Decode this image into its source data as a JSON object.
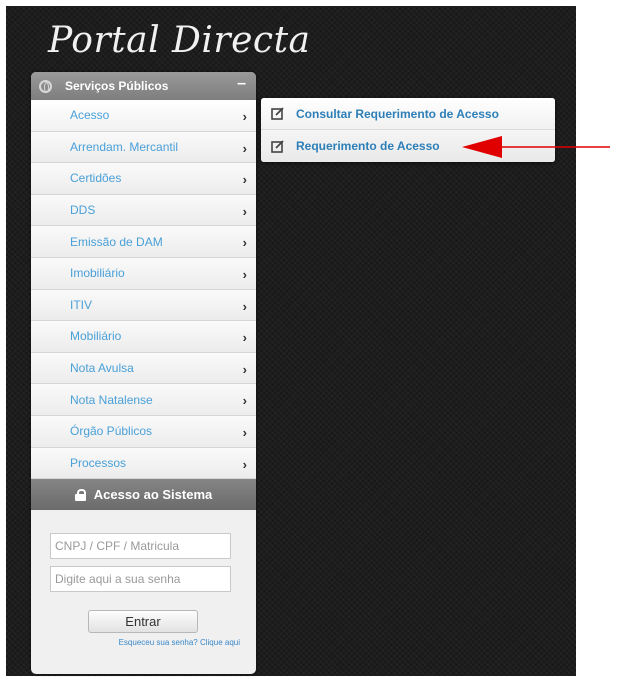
{
  "logo": "Portal Directa",
  "section": {
    "title": "Serviços Públicos",
    "toggle": "–",
    "icon": "globe-icon"
  },
  "menu": [
    {
      "label": "Acesso",
      "chevron": "›"
    },
    {
      "label": "Arrendam. Mercantil",
      "chevron": "›"
    },
    {
      "label": "Certidões",
      "chevron": "›"
    },
    {
      "label": "DDS",
      "chevron": "›"
    },
    {
      "label": "Emissão de DAM",
      "chevron": "›"
    },
    {
      "label": "Imobiliário",
      "chevron": "›"
    },
    {
      "label": "ITIV",
      "chevron": "›"
    },
    {
      "label": "Mobiliário",
      "chevron": "›"
    },
    {
      "label": "Nota Avulsa",
      "chevron": "›"
    },
    {
      "label": "Nota Natalense",
      "chevron": "›"
    },
    {
      "label": "Órgão Públicos",
      "chevron": "›"
    },
    {
      "label": "Processos",
      "chevron": "›"
    }
  ],
  "system": {
    "title": "Acesso ao Sistema",
    "icon": "lock-icon"
  },
  "login": {
    "user_placeholder": "CNPJ / CPF / Matricula",
    "password_placeholder": "Digite aqui a sua senha",
    "button_label": "Entrar",
    "forgot_link": "Esqueceu sua senha? Clique aqui"
  },
  "submenu": [
    {
      "label": "Consultar Requerimento de Acesso",
      "icon": "edit-icon"
    },
    {
      "label": "Requerimento de Acesso",
      "icon": "edit-icon"
    }
  ],
  "colors": {
    "background": "#1d1d1d",
    "menu_text": "#4aa0d8",
    "submenu_text": "#2d7fb8",
    "annotation_arrow": "#e00000"
  }
}
